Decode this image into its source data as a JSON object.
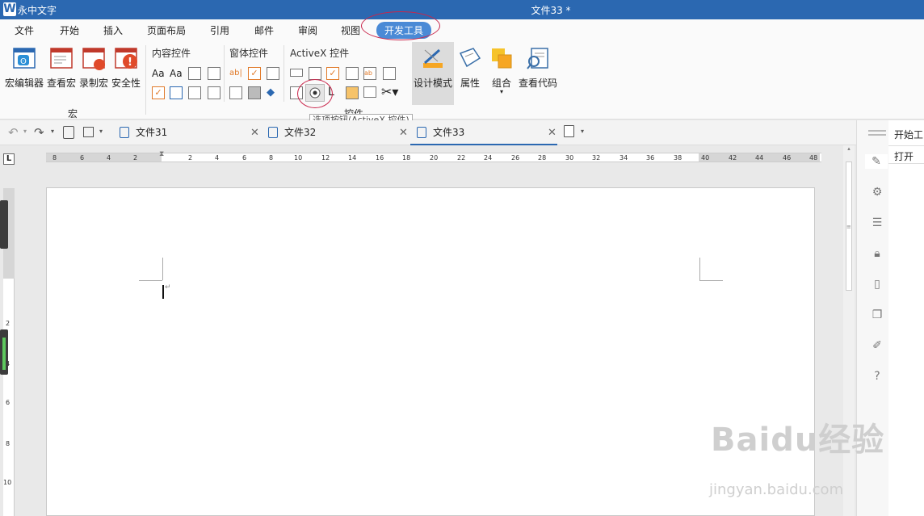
{
  "titlebar": {
    "app_name": "永中文字",
    "doc_title": "文件33 *"
  },
  "menu": {
    "tabs": [
      "文件",
      "开始",
      "插入",
      "页面布局",
      "引用",
      "邮件",
      "审阅",
      "视图",
      "开发工具"
    ],
    "active": "开发工具"
  },
  "ribbon": {
    "macro": {
      "label": "宏",
      "buttons": [
        "宏编辑器",
        "查看宏",
        "录制宏",
        "安全性"
      ]
    },
    "content_controls": {
      "label": "内容控件"
    },
    "form_controls": {
      "label": "窗体控件"
    },
    "activex": {
      "label": "ActiveX 控件"
    },
    "controls_group_label": "控件",
    "big_buttons": [
      "设计模式",
      "属性",
      "组合",
      "查看代码"
    ],
    "tooltip": "选项按钮(ActiveX 控件)"
  },
  "doc_tabs": [
    "文件31",
    "文件32",
    "文件33"
  ],
  "ruler": {
    "left": [
      "8",
      "6",
      "4",
      "2"
    ],
    "right": [
      "2",
      "4",
      "6",
      "8",
      "10",
      "12",
      "14",
      "16",
      "18",
      "20",
      "22",
      "24",
      "26",
      "28",
      "30",
      "32",
      "34",
      "36",
      "38",
      "40",
      "42",
      "44",
      "46",
      "48"
    ],
    "vertical": [
      "2",
      "4",
      "6",
      "8",
      "10"
    ]
  },
  "right_panel": {
    "start": "开始工",
    "open": "打开"
  },
  "watermark": {
    "main": "Baidu经验",
    "sub": "jingyan.baidu.com"
  }
}
